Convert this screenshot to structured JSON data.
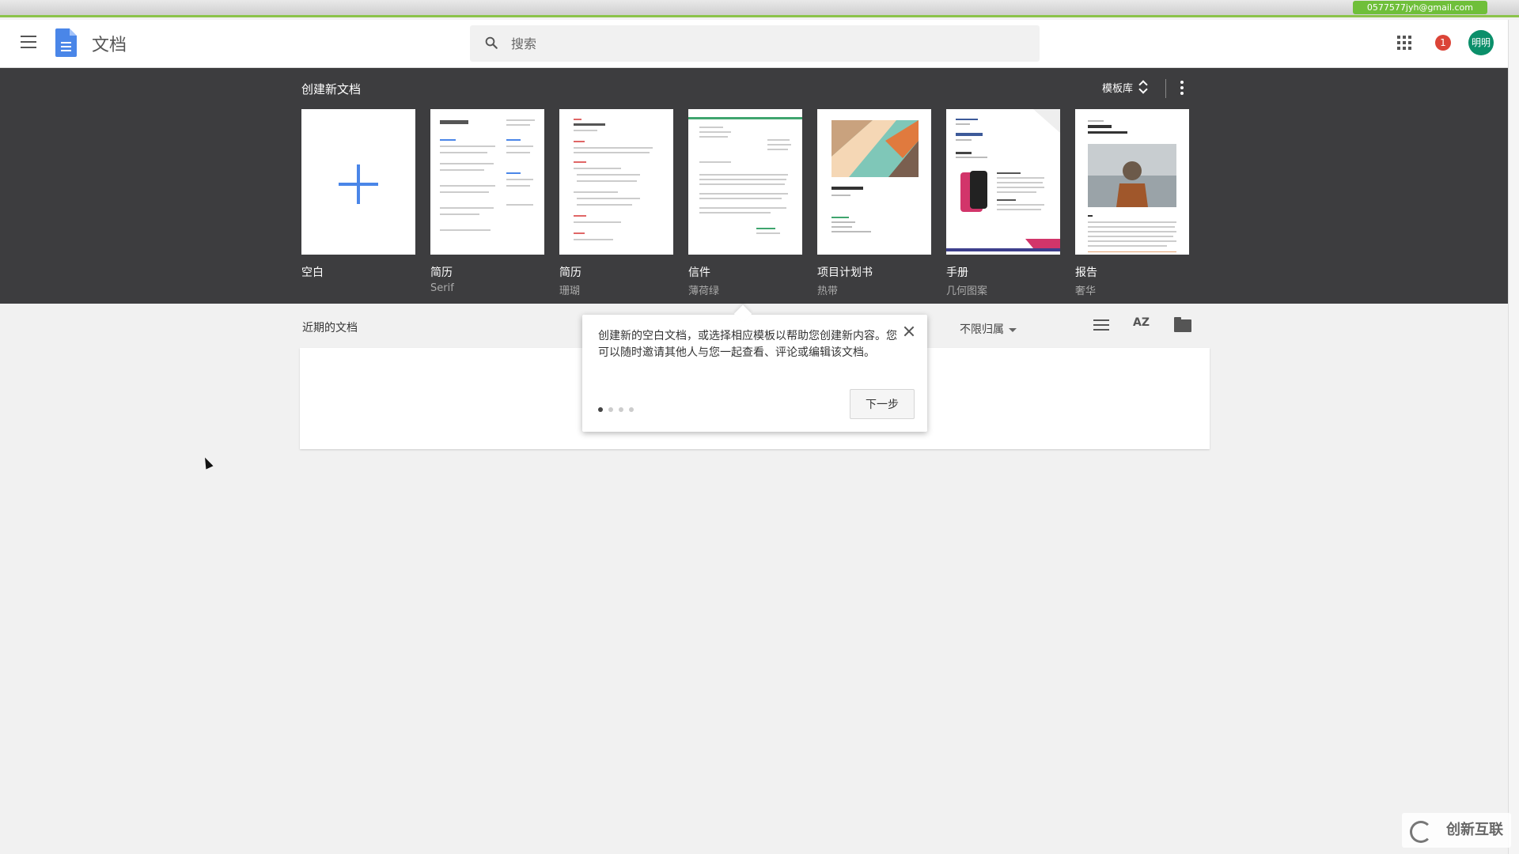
{
  "account": {
    "email": "0577577jyh@gmail.com"
  },
  "header": {
    "app_title": "文档",
    "search_placeholder": "搜索",
    "notification_count": "1",
    "avatar_text": "明明"
  },
  "templates": {
    "section_title": "创建新文档",
    "gallery_label": "模板库",
    "items": [
      {
        "name": "空白",
        "sub": ""
      },
      {
        "name": "简历",
        "sub": "Serif"
      },
      {
        "name": "简历",
        "sub": "珊瑚"
      },
      {
        "name": "信件",
        "sub": "薄荷绿"
      },
      {
        "name": "项目计划书",
        "sub": "热带"
      },
      {
        "name": "手册",
        "sub": "几何图案"
      },
      {
        "name": "报告",
        "sub": "奢华"
      }
    ]
  },
  "recent": {
    "title": "近期的文档",
    "owner_filter": "不限归属",
    "sort_label": "AZ"
  },
  "tooltip": {
    "text": "创建新的空白文档，或选择相应模板以帮助您创建新内容。您可以随时邀请其他人与您一起查看、评论或编辑该文档。",
    "next_label": "下一步",
    "step_count": 4,
    "active_step": 1
  },
  "watermark": {
    "corner_text": "创新互联"
  },
  "colors": {
    "accent": "#4a86e8",
    "band": "#3d3d3f",
    "avatar": "#0b8f6a",
    "notification": "#db4437"
  }
}
